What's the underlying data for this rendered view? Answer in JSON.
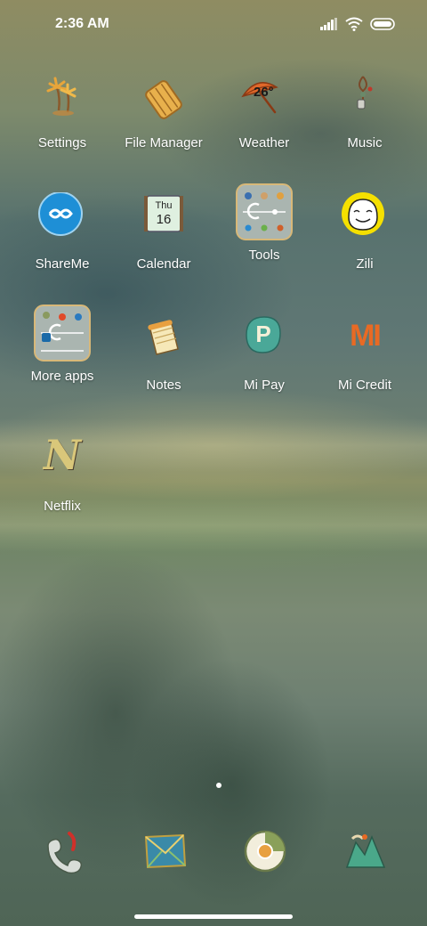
{
  "status_bar": {
    "time": "2:36 AM"
  },
  "apps": [
    {
      "label": "Settings",
      "icon": "palm-tree-icon"
    },
    {
      "label": "File Manager",
      "icon": "scroll-folder-icon"
    },
    {
      "label": "Weather",
      "icon": "umbrella-icon",
      "badge": "26°"
    },
    {
      "label": "Music",
      "icon": "pendant-icon"
    },
    {
      "label": "ShareMe",
      "icon": "infinity-icon"
    },
    {
      "label": "Calendar",
      "icon": "calendar-icon",
      "day": "Thu",
      "date": "16"
    },
    {
      "label": "Tools",
      "icon": "folder-icon"
    },
    {
      "label": "Zili",
      "icon": "smiley-ghost-icon"
    },
    {
      "label": "More apps",
      "icon": "folder-icon"
    },
    {
      "label": "Notes",
      "icon": "notepad-icon"
    },
    {
      "label": "Mi Pay",
      "icon": "p-leaf-icon",
      "glyph": "P"
    },
    {
      "label": "Mi Credit",
      "icon": "mi-logo-icon",
      "glyph": "MI"
    },
    {
      "label": "Netflix",
      "icon": "netflix-icon",
      "glyph": "N"
    }
  ],
  "dock": [
    {
      "icon": "phone-icon"
    },
    {
      "icon": "messages-icon"
    },
    {
      "icon": "browser-icon"
    },
    {
      "icon": "camera-icon"
    }
  ],
  "pager": {
    "pages": 2,
    "active": 2
  },
  "colors": {
    "text": "#ffffff",
    "accent_orange": "#e0682a",
    "accent_teal": "#3aa5a0"
  }
}
